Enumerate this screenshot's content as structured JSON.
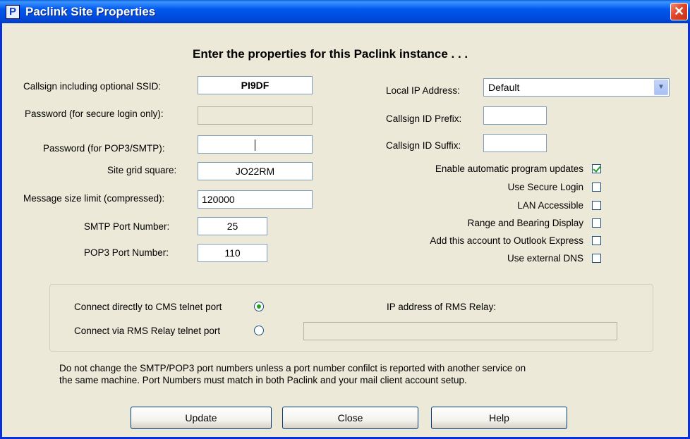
{
  "window": {
    "title": "Paclink Site Properties",
    "close_glyph": "✕",
    "icon": "paclink-app-icon",
    "icon_glyph": "P"
  },
  "heading": "Enter the properties for this Paclink instance . . .",
  "left_form": {
    "callsign": {
      "label": "Callsign including optional SSID:",
      "value": "PI9DF"
    },
    "password_secure": {
      "label": "Password (for secure login only):",
      "value": ""
    },
    "password_pop3": {
      "label": "Password (for POP3/SMTP):",
      "value": ""
    },
    "grid_square": {
      "label": "Site grid square:",
      "value": "JO22RM"
    },
    "size_limit": {
      "label": "Message size limit (compressed):",
      "value": "120000"
    },
    "smtp_port": {
      "label": "SMTP Port Number:",
      "value": "25"
    },
    "pop3_port": {
      "label": "POP3 Port Number:",
      "value": "110"
    }
  },
  "right_form": {
    "local_ip": {
      "label": "Local IP Address:",
      "value": "Default"
    },
    "prefix": {
      "label": "Callsign ID Prefix:",
      "value": ""
    },
    "suffix": {
      "label": "Callsign ID Suffix:",
      "value": ""
    }
  },
  "checkboxes": [
    {
      "label": "Enable automatic program updates",
      "checked": true
    },
    {
      "label": "Use Secure Login",
      "checked": false
    },
    {
      "label": "LAN Accessible",
      "checked": false
    },
    {
      "label": "Range and Bearing Display",
      "checked": false
    },
    {
      "label": "Add this account to Outlook Express",
      "checked": false
    },
    {
      "label": "Use external DNS",
      "checked": false
    }
  ],
  "connection": {
    "direct_label": "Connect directly to CMS telnet port",
    "direct_selected": true,
    "relay_label": "Connect via RMS Relay telnet port",
    "relay_selected": false,
    "relay_ip_label": "IP address of RMS Relay:",
    "relay_ip_value": ""
  },
  "note": {
    "line1": "Do not change the SMTP/POP3  port numbers unless a port number confilct is reported with another service on",
    "line2": "the same machine.  Port Numbers must match in both Paclink and your mail client account setup."
  },
  "buttons": {
    "update": "Update",
    "close": "Close",
    "help": "Help"
  },
  "colors": {
    "titlebar": "#0054e3",
    "window_bg": "#ece9d8",
    "check_green": "#21a121"
  }
}
